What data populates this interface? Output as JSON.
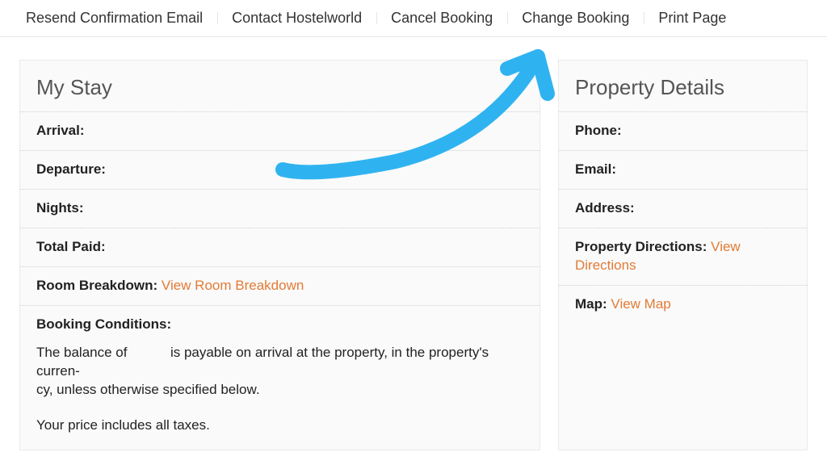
{
  "actions": {
    "resend": "Resend Confirmation Email",
    "contact": "Contact Hostelworld",
    "cancel": "Cancel Booking",
    "change": "Change Booking",
    "print": "Print Page"
  },
  "mystay": {
    "title": "My Stay",
    "arrival_label": "Arrival:",
    "arrival_value": "",
    "departure_label": "Departure:",
    "departure_value": "",
    "nights_label": "Nights:",
    "nights_value": "",
    "total_paid_label": "Total Paid:",
    "total_paid_value": "",
    "room_breakdown_label": "Room Breakdown:",
    "room_breakdown_link": "View Room Breakdown",
    "conditions_label": "Booking Conditions:",
    "conditions_text_1a": "The balance of",
    "conditions_text_1b": "is payable on arrival at the property, in the property's curren-",
    "conditions_text_1c": "cy, unless otherwise specified below.",
    "conditions_text_2": "Your price includes all taxes."
  },
  "property": {
    "title": "Property Details",
    "phone_label": "Phone:",
    "phone_value": "",
    "email_label": "Email:",
    "email_value": "",
    "address_label": "Address:",
    "address_value": "",
    "directions_label": "Property Directions:",
    "directions_link": "View Directions",
    "map_label": "Map:",
    "map_link": "View Map"
  },
  "colors": {
    "link": "#e27b35",
    "arrow": "#2fb3f0"
  }
}
